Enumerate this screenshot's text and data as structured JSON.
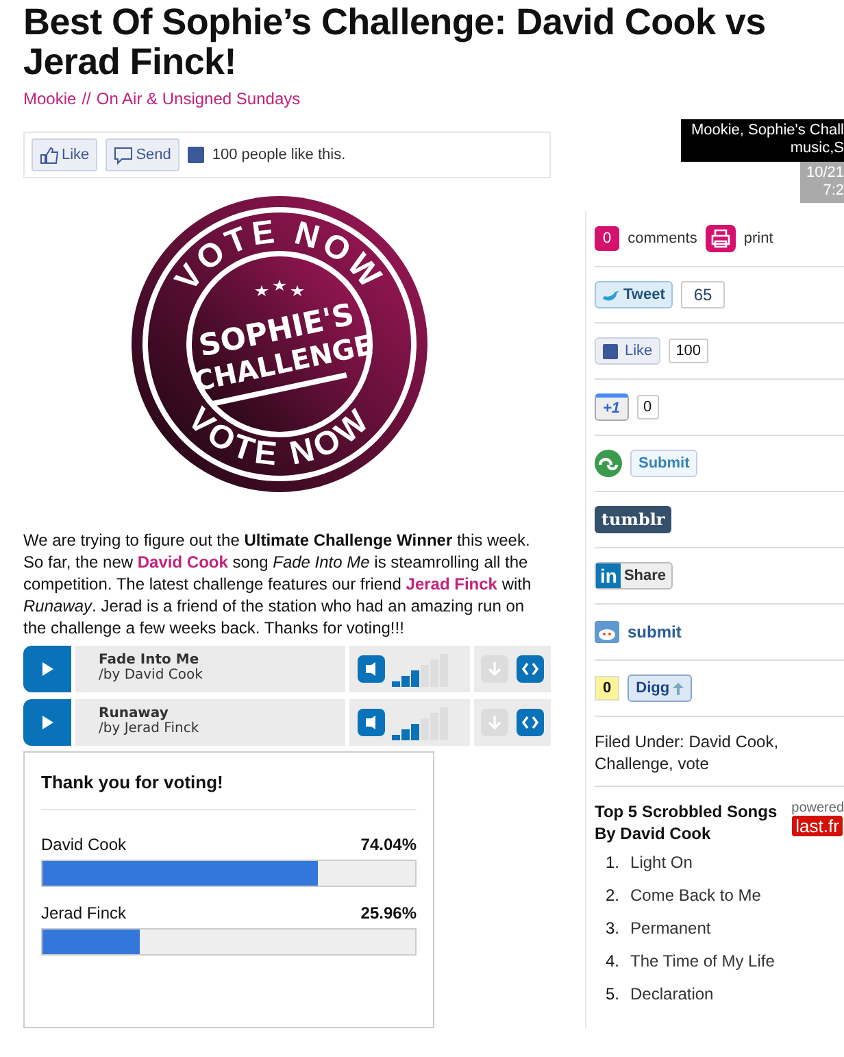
{
  "title": "Best Of Sophie’s Challenge: David Cook vs Jerad Finck!",
  "byline": {
    "author": "Mookie",
    "separator": "//",
    "category": "On Air & Unsigned Sundays"
  },
  "overlay": {
    "caption_lines": [
      "Mookie, Sophie's Chall",
      "music,S"
    ],
    "date_lines": [
      "10/21",
      "7:2"
    ]
  },
  "like_bar": {
    "like": "Like",
    "send": "Send",
    "count_text": "100 people like this."
  },
  "stamp": {
    "ring_top": "VOTE NOW",
    "ring_bottom": "VOTE NOW",
    "banner_lines": [
      "SOPHIE'S",
      "CHALLENGE"
    ]
  },
  "paragraph": [
    {
      "kind": "text",
      "text": "We are trying to figure out the "
    },
    {
      "kind": "bold",
      "text": "Ultimate Challenge Winner"
    },
    {
      "kind": "text",
      "text": " this week. So far, the new "
    },
    {
      "kind": "link",
      "text": "David Cook"
    },
    {
      "kind": "text",
      "text": " song "
    },
    {
      "kind": "italic",
      "text": "Fade Into Me"
    },
    {
      "kind": "text",
      "text": " is steamrolling all the competition. The latest challenge features our friend "
    },
    {
      "kind": "link",
      "text": "Jerad Finck"
    },
    {
      "kind": "text",
      "text": " with "
    },
    {
      "kind": "italic",
      "text": "Runaway"
    },
    {
      "kind": "text",
      "text": ". Jerad is a friend of the station who had an amazing run on the challenge a few weeks back. Thanks for voting!!!"
    }
  ],
  "tracks": [
    {
      "title": "Fade Into Me",
      "artist": "/by David Cook",
      "level": 0.5
    },
    {
      "title": "Runaway",
      "artist": "/by Jerad Finck",
      "level": 0.5
    }
  ],
  "poll": {
    "heading": "Thank you for voting!",
    "results": [
      {
        "name": "David Cook",
        "percent": "74.04%",
        "level": 0.7404
      },
      {
        "name": "Jerad Finck",
        "percent": "25.96%",
        "level": 0.2596
      }
    ]
  },
  "sidebar": {
    "comments": {
      "count": "0",
      "label": "comments",
      "print": "print"
    },
    "share": [
      {
        "kind": "tweet",
        "label": "Tweet",
        "count": "65"
      },
      {
        "kind": "fblike",
        "label": "Like",
        "count": "100"
      },
      {
        "kind": "plusone",
        "label": "+1",
        "count": "0"
      },
      {
        "kind": "stumble",
        "label": "Submit"
      },
      {
        "kind": "tumblr",
        "label": "tumblr"
      },
      {
        "kind": "linkedin",
        "label": "Share",
        "badge": "in"
      },
      {
        "kind": "reddit",
        "label": "submit"
      },
      {
        "kind": "digg",
        "label": "Digg",
        "count": "0"
      }
    ],
    "filed_under": {
      "label": "Filed Under:",
      "tags": [
        "David Cook,",
        "Challenge,",
        "vote"
      ]
    },
    "scrobbled": {
      "heading_lines": [
        "Top 5 Scrobbled Songs",
        "By David Cook"
      ],
      "powered": "powered",
      "service": "last.fr",
      "songs": [
        {
          "number": "1.",
          "title": "Light On"
        },
        {
          "number": "2.",
          "title": "Come Back to Me"
        },
        {
          "number": "3.",
          "title": "Permanent"
        },
        {
          "number": "4.",
          "title": "The Time of My Life"
        },
        {
          "number": "5.",
          "title": "Declaration"
        }
      ]
    }
  }
}
